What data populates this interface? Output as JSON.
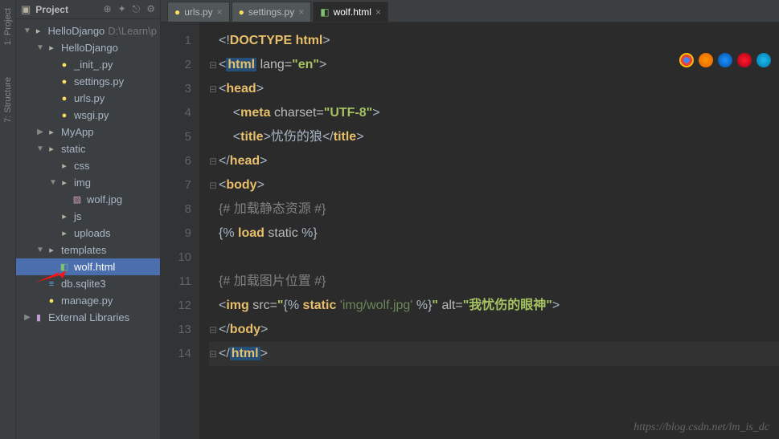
{
  "sidebar": {
    "title": "Project",
    "tools": [
      "⊕",
      "✦",
      "⎋",
      "⚙"
    ],
    "tree": [
      {
        "indent": 0,
        "arrow": "▼",
        "icon": "folder",
        "label": "HelloDjango",
        "suffix": "D:\\Learn\\p"
      },
      {
        "indent": 1,
        "arrow": "▼",
        "icon": "folder",
        "label": "HelloDjango"
      },
      {
        "indent": 2,
        "arrow": "",
        "icon": "py",
        "label": "_init_.py"
      },
      {
        "indent": 2,
        "arrow": "",
        "icon": "py",
        "label": "settings.py"
      },
      {
        "indent": 2,
        "arrow": "",
        "icon": "py",
        "label": "urls.py"
      },
      {
        "indent": 2,
        "arrow": "",
        "icon": "py",
        "label": "wsgi.py"
      },
      {
        "indent": 1,
        "arrow": "▶",
        "icon": "folder",
        "label": "MyApp"
      },
      {
        "indent": 1,
        "arrow": "▼",
        "icon": "folder",
        "label": "static"
      },
      {
        "indent": 2,
        "arrow": "",
        "icon": "folder",
        "label": "css"
      },
      {
        "indent": 2,
        "arrow": "▼",
        "icon": "folder",
        "label": "img"
      },
      {
        "indent": 3,
        "arrow": "",
        "icon": "img",
        "label": "wolf.jpg"
      },
      {
        "indent": 2,
        "arrow": "",
        "icon": "folder",
        "label": "js"
      },
      {
        "indent": 2,
        "arrow": "",
        "icon": "folder",
        "label": "uploads"
      },
      {
        "indent": 1,
        "arrow": "▼",
        "icon": "folder",
        "label": "templates"
      },
      {
        "indent": 2,
        "arrow": "",
        "icon": "html",
        "label": "wolf.html",
        "selected": true
      },
      {
        "indent": 1,
        "arrow": "",
        "icon": "db",
        "label": "db.sqlite3"
      },
      {
        "indent": 1,
        "arrow": "",
        "icon": "py",
        "label": "manage.py"
      },
      {
        "indent": 0,
        "arrow": "▶",
        "icon": "lib",
        "label": "External Libraries"
      }
    ]
  },
  "tabs": [
    {
      "icon": "py",
      "label": "urls.py",
      "active": false
    },
    {
      "icon": "py",
      "label": "settings.py",
      "active": false
    },
    {
      "icon": "html",
      "label": "wolf.html",
      "active": true
    }
  ],
  "gutter_labels": [
    "1: Project",
    "7: Structure"
  ],
  "code": {
    "current_line": 14,
    "lines": [
      {
        "n": 1,
        "html": "<span class='t-punct'>&lt;!</span><span class='t-tag'>DOCTYPE html</span><span class='t-punct'>&gt;</span>"
      },
      {
        "n": 2,
        "fold": "⊟",
        "html": "<span class='t-punct'>&lt;</span><span class='t-tag-html'>html</span> <span class='t-attr'>lang=</span><span class='t-val'>\"en\"</span><span class='t-punct'>&gt;</span>"
      },
      {
        "n": 3,
        "fold": "⊟",
        "html": "<span class='t-punct'>&lt;</span><span class='t-tag'>head</span><span class='t-punct'>&gt;</span>"
      },
      {
        "n": 4,
        "html": "    <span class='t-punct'>&lt;</span><span class='t-tag'>meta</span> <span class='t-attr'>charset=</span><span class='t-val'>\"UTF-8\"</span><span class='t-punct'>&gt;</span>"
      },
      {
        "n": 5,
        "html": "    <span class='t-punct'>&lt;</span><span class='t-tag'>title</span><span class='t-punct'>&gt;</span><span class='t-text'>忧伤的狼</span><span class='t-punct'>&lt;/</span><span class='t-tag'>title</span><span class='t-punct'>&gt;</span>"
      },
      {
        "n": 6,
        "fold": "⊟",
        "html": "<span class='t-punct'>&lt;/</span><span class='t-tag'>head</span><span class='t-punct'>&gt;</span>"
      },
      {
        "n": 7,
        "fold": "⊟",
        "html": "<span class='t-punct'>&lt;</span><span class='t-tag'>body</span><span class='t-punct'>&gt;</span>"
      },
      {
        "n": 8,
        "html": "<span class='t-comment'>{# 加载静态资源 #}</span>"
      },
      {
        "n": 9,
        "html": "<span class='t-punct'>{%</span> <span class='t-dj'>load</span> <span class='t-attr'>static</span> <span class='t-punct'>%}</span>"
      },
      {
        "n": 10,
        "html": ""
      },
      {
        "n": 11,
        "html": "<span class='t-comment'>{# 加载图片位置 #}</span>"
      },
      {
        "n": 12,
        "html": "<span class='t-punct'>&lt;</span><span class='t-tag'>img</span> <span class='t-attr'>src=</span><span class='t-val'>\"</span><span class='t-punct'>{%</span> <span class='t-dj'>static</span> <span class='t-str'>'img/wolf.jpg'</span> <span class='t-punct'>%}</span><span class='t-val'>\"</span> <span class='t-attr'>alt=</span><span class='t-val'>\"我忧伤的眼神\"</span><span class='t-punct'>&gt;</span>"
      },
      {
        "n": 13,
        "fold": "⊟",
        "html": "<span class='t-punct'>&lt;/</span><span class='t-tag'>body</span><span class='t-punct'>&gt;</span>"
      },
      {
        "n": 14,
        "fold": "⊟",
        "html": "<span class='t-punct'>&lt;/</span><span class='t-tag-html'>html</span><span class='t-punct'>&gt;</span>"
      }
    ]
  },
  "watermark": "https://blog.csdn.net/lm_is_dc"
}
